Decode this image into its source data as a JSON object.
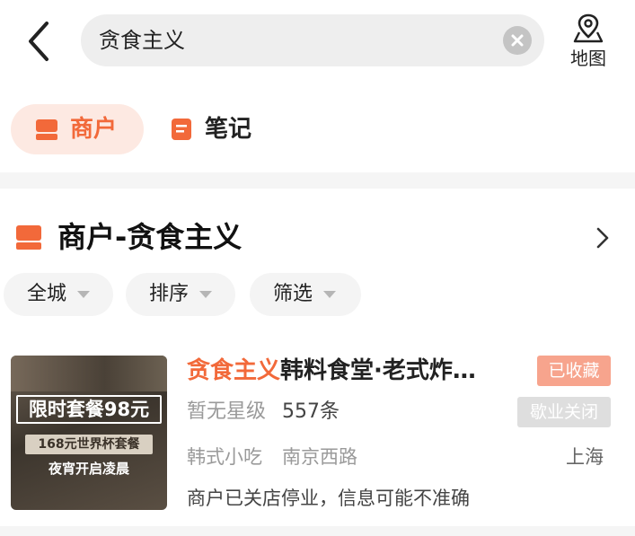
{
  "colors": {
    "accent": "#f2693a",
    "accent_soft": "#fde9e2",
    "fav_badge": "#f7a48d",
    "closed_badge": "#dedede"
  },
  "header": {
    "back_icon": "chevron-left-icon",
    "search": {
      "value": "贪食主义",
      "clear_icon": "clear-circle-icon"
    },
    "map": {
      "icon": "map-pin-icon",
      "label": "地图"
    }
  },
  "tabs": [
    {
      "label": "商户",
      "icon": "shop-icon",
      "selected": true
    },
    {
      "label": "笔记",
      "icon": "note-icon",
      "selected": false
    }
  ],
  "section": {
    "icon": "shop-icon",
    "title": "商户-贪食主义",
    "more_icon": "chevron-right-icon",
    "filters": [
      {
        "label": "全城",
        "icon": "caret-down-icon"
      },
      {
        "label": "排序",
        "icon": "caret-down-icon"
      },
      {
        "label": "筛选",
        "icon": "caret-down-icon"
      }
    ]
  },
  "result": {
    "thumbnail": {
      "line1": "限时套餐98元",
      "line2": "168元世界杯套餐",
      "line3": "夜宵开启凌晨"
    },
    "name_highlight": "贪食主义",
    "name_rest": "韩料食堂·老式炸…",
    "fav_badge": "已收藏",
    "closed_badge": "歇业关闭",
    "rating": "暂无星级",
    "reviews": "557条",
    "category": "韩式小吃",
    "area": "南京西路",
    "city": "上海",
    "notice": "商户已关店停业，信息可能不准确"
  }
}
